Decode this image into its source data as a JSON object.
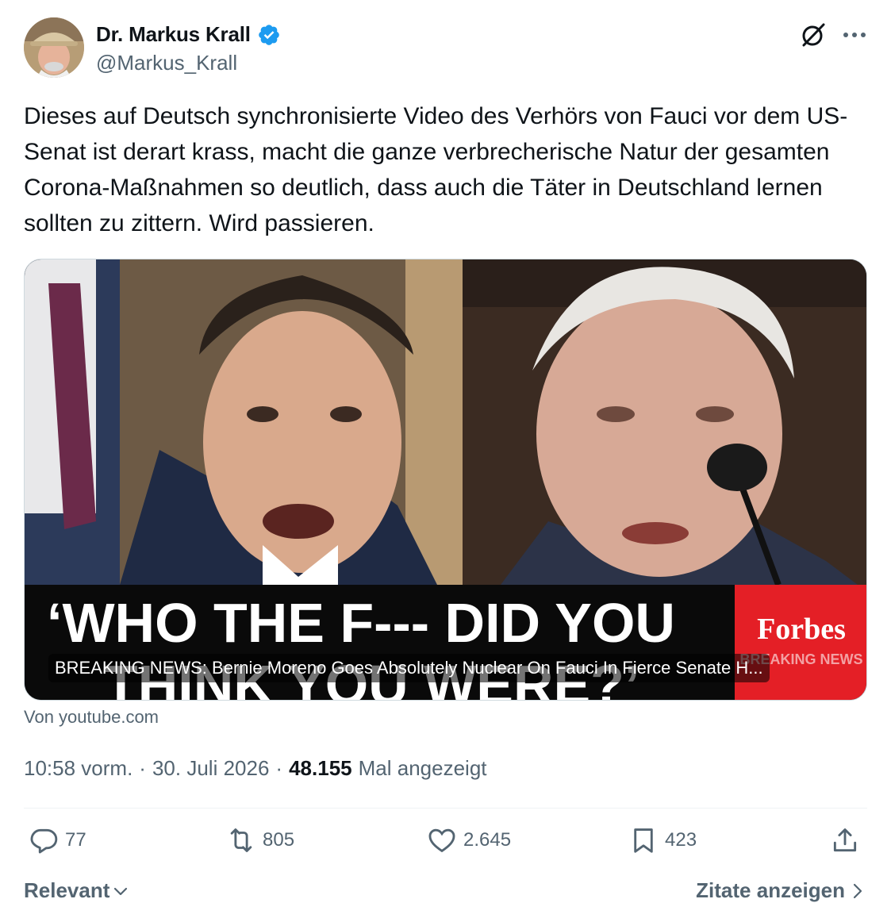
{
  "author": {
    "display_name": "Dr. Markus Krall",
    "handle": "@Markus_Krall",
    "verified_icon": "verified-badge-icon",
    "avatar": "avatar"
  },
  "header_icons": [
    "grok-icon",
    "more-icon"
  ],
  "tweet": {
    "text": "Dieses auf Deutsch synchronisierte Video des Verhörs von Fauci vor dem US-Senat ist derart krass, macht die ganze verbrecherische Natur der gesamten Corona-Maßnahmen so deutlich, dass auch die Täter in Deutschland lernen sollten zu zittern. Wird passieren."
  },
  "card": {
    "headline_line1": "‘WHO THE F--- DID YOU",
    "headline_line2": "THINK YOU WERE?’",
    "brand": "Forbes",
    "brand_sub": "BREAKING NEWS",
    "title": "BREAKING NEWS: Bernie Moreno Goes Absolutely Nuclear On Fauci In Fierce Senate H...",
    "source": "Von youtube.com"
  },
  "meta": {
    "time": "10:58 vorm.",
    "separator": "·",
    "date": "30. Juli 2026",
    "views_count": "48.155",
    "views_label": "Mal angezeigt"
  },
  "actions": {
    "replies": "77",
    "reposts": "805",
    "likes": "2.645",
    "bookmarks": "423"
  },
  "footer": {
    "sort_label": "Relevant",
    "quotes_label": "Zitate anzeigen"
  },
  "colors": {
    "text": "#0f1419",
    "secondary": "#536471",
    "verified": "#1d9bf0",
    "forbes_red": "#e41f26"
  }
}
